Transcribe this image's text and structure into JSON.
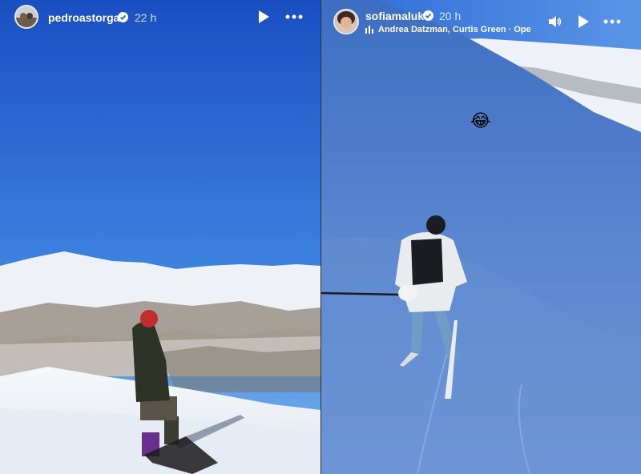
{
  "left_story": {
    "username": "pedroastorga",
    "time": "22 h",
    "icons": {
      "verified": "verified-badge-icon",
      "play": "play-icon",
      "more": "more-options-icon"
    }
  },
  "right_story": {
    "username": "sofiamaluk",
    "time": "20 h",
    "music_text": "Andrea Datzman, Curtis Green · Ope",
    "emoji": "😂",
    "icons": {
      "verified": "verified-badge-icon",
      "music": "music-bars-icon",
      "volume": "volume-icon",
      "play": "play-icon",
      "more": "more-options-icon"
    }
  },
  "colors": {
    "sky_top": "#1a55c7",
    "sky_bottom": "#5d9be8",
    "snow": "#f1f5fa",
    "slope": "#4f7fc8"
  }
}
